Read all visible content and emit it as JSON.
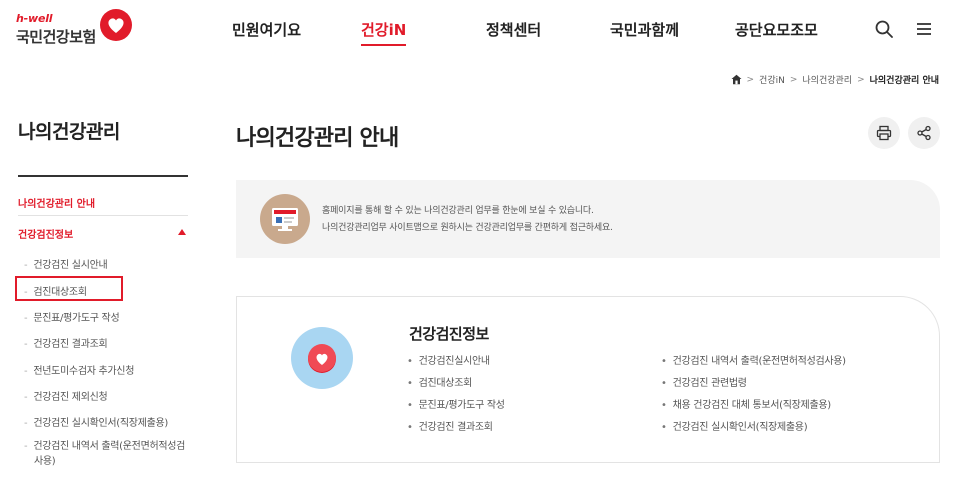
{
  "header": {
    "logo": {
      "tagline": "h-well",
      "name": "국민건강보험"
    },
    "nav": [
      {
        "label": "민원여기요"
      },
      {
        "label": "건강iN",
        "active": true
      },
      {
        "label": "정책센터"
      },
      {
        "label": "국민과함께"
      },
      {
        "label": "공단요모조모"
      }
    ],
    "icons": {
      "search": "search-icon",
      "menu": "hamburger-menu-icon"
    }
  },
  "breadcrumb": {
    "home_icon": "home-icon",
    "items": [
      "건강iN",
      "나의건강관리",
      "나의건강관리 안내"
    ]
  },
  "sidebar": {
    "title": "나의건강관리",
    "sections": [
      {
        "label": "나의건강관리 안내"
      },
      {
        "label": "건강검진정보",
        "expanded": true
      }
    ],
    "subitems": [
      {
        "label": "건강검진 실시안내"
      },
      {
        "label": "검진대상조회",
        "highlighted": true
      },
      {
        "label": "문진표/평가도구 작성"
      },
      {
        "label": "건강검진 결과조회"
      },
      {
        "label": "전년도미수검자 추가신청"
      },
      {
        "label": "건강검진 제외신청"
      },
      {
        "label": "건강검진 실시확인서(직장제출용)"
      },
      {
        "label": "건강검진 내역서 출력(운전면허적성검사용)"
      }
    ]
  },
  "main": {
    "title": "나의건강관리 안내",
    "actions": {
      "print": "print-icon",
      "share": "share-icon"
    },
    "intro": {
      "lines": [
        "홈페이지를 통해 할 수 있는 나의건강관리 업무를 한눈에 보실 수 있습니다.",
        "나의건강관리업무 사이트맵으로 원하시는 건강관리업무를 간편하게 접근하세요."
      ]
    },
    "card": {
      "title": "건강검진정보",
      "left_links": [
        "건강검진실시안내",
        "검진대상조회",
        "문진표/평가도구 작성",
        "건강검진 결과조회"
      ],
      "right_links": [
        "건강검진 내역서 출력(운전면허적성검사용)",
        "건강검진 관련법령",
        "채용 건강검진 대체 통보서(직장제출용)",
        "건강검진 실시확인서(직장제출용)"
      ]
    }
  },
  "colors": {
    "accent": "#e11b2a",
    "text": "#222222",
    "muted": "#555555",
    "panel": "#f4f4f4"
  }
}
